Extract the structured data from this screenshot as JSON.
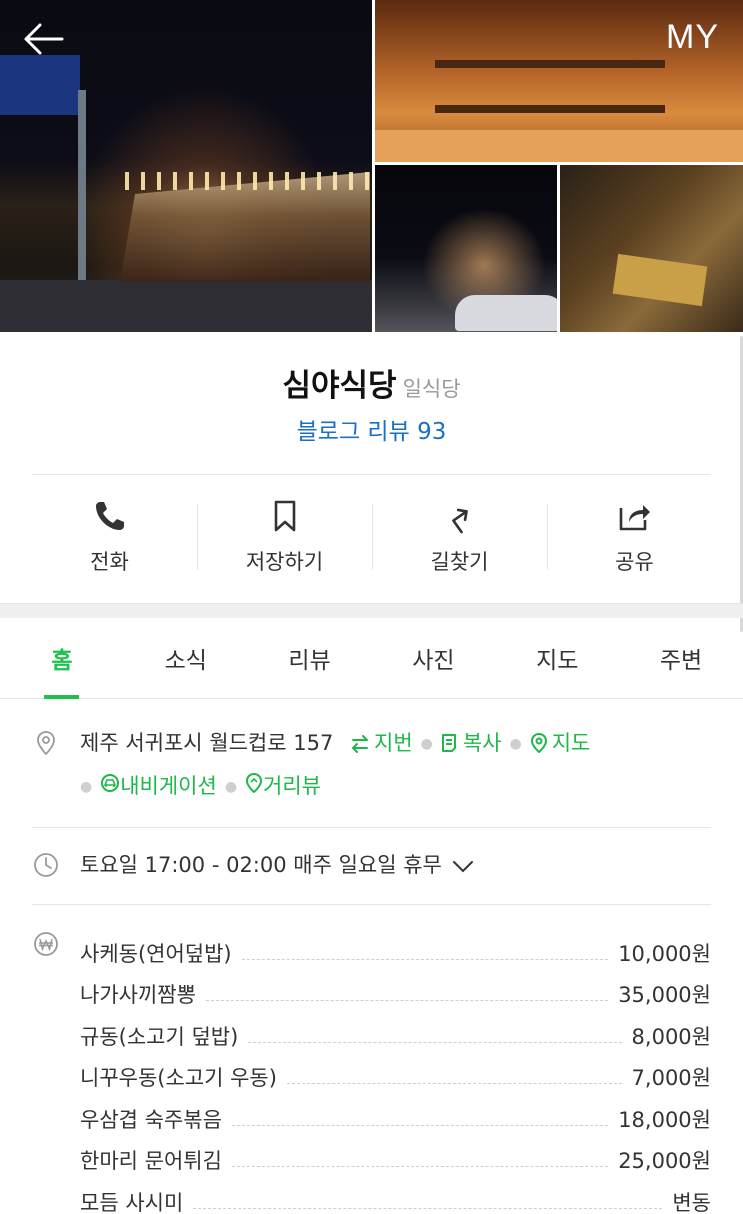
{
  "header": {
    "my_label": "MY"
  },
  "place": {
    "name": "심야식당",
    "category": "일식당",
    "blog_review": "블로그 리뷰 93"
  },
  "actions": [
    {
      "label": "전화",
      "icon": "phone-icon"
    },
    {
      "label": "저장하기",
      "icon": "bookmark-icon"
    },
    {
      "label": "길찾기",
      "icon": "directions-icon"
    },
    {
      "label": "공유",
      "icon": "share-icon"
    }
  ],
  "tabs": [
    {
      "label": "홈",
      "active": true
    },
    {
      "label": "소식"
    },
    {
      "label": "리뷰"
    },
    {
      "label": "사진"
    },
    {
      "label": "지도"
    },
    {
      "label": "주변"
    }
  ],
  "address": {
    "text": "제주 서귀포시 월드컵로 157",
    "jibun": "지번",
    "copy": "복사",
    "map": "지도",
    "navigation": "내비게이션",
    "street_view": "거리뷰"
  },
  "hours": {
    "text": "토요일 17:00 - 02:00 매주 일요일 휴무"
  },
  "menu": [
    {
      "name": "사케동(연어덮밥)",
      "price": "10,000원"
    },
    {
      "name": "나가사끼짬뽕",
      "price": "35,000원"
    },
    {
      "name": "규동(소고기 덮밥)",
      "price": "8,000원"
    },
    {
      "name": "니꾸우동(소고기 우동)",
      "price": "7,000원"
    },
    {
      "name": "우삼겹 숙주볶음",
      "price": "18,000원"
    },
    {
      "name": "한마리 문어튀김",
      "price": "25,000원"
    },
    {
      "name": "모듬 사시미",
      "price": "변동"
    }
  ],
  "colors": {
    "accent_green": "#1ec14b",
    "link_blue": "#1a6fc9"
  }
}
